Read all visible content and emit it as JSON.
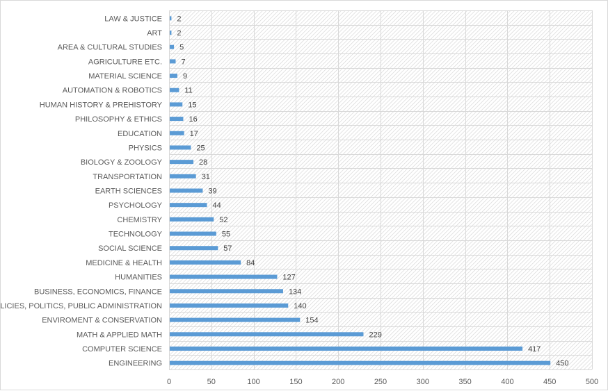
{
  "chart_data": {
    "type": "bar",
    "orientation": "horizontal",
    "title": "",
    "xlabel": "",
    "ylabel": "",
    "xlim": [
      0,
      500
    ],
    "x_ticks": [
      0,
      50,
      100,
      150,
      200,
      250,
      300,
      350,
      400,
      450,
      500
    ],
    "grid": true,
    "legend": "none",
    "bar_color": "#5B9BD5",
    "data_labels": true,
    "categories": [
      "LAW & JUSTICE",
      "ART",
      "AREA & CULTURAL STUDIES",
      "AGRICULTURE ETC.",
      "MATERIAL SCIENCE",
      "AUTOMATION & ROBOTICS",
      "HUMAN HISTORY & PREHISTORY",
      "PHILOSOPHY & ETHICS",
      "EDUCATION",
      "PHYSICS",
      "BIOLOGY & ZOOLOGY",
      "TRANSPORTATION",
      "EARTH SCIENCES",
      "PSYCHOLOGY",
      "CHEMISTRY",
      "TECHNOLOGY",
      "SOCIAL SCIENCE",
      "MEDICINE & HEALTH",
      "HUMANITIES",
      "BUSINESS, ECONOMICS, FINANCE",
      "POLICIES, POLITICS, PUBLIC ADMINISTRATION",
      "ENVIROMENT & CONSERVATION",
      "MATH & APPLIED MATH",
      "COMPUTER SCIENCE",
      "ENGINEERING"
    ],
    "values": [
      2,
      2,
      5,
      7,
      9,
      11,
      15,
      16,
      17,
      25,
      28,
      31,
      39,
      44,
      52,
      55,
      57,
      84,
      127,
      134,
      140,
      154,
      229,
      417,
      450
    ]
  }
}
